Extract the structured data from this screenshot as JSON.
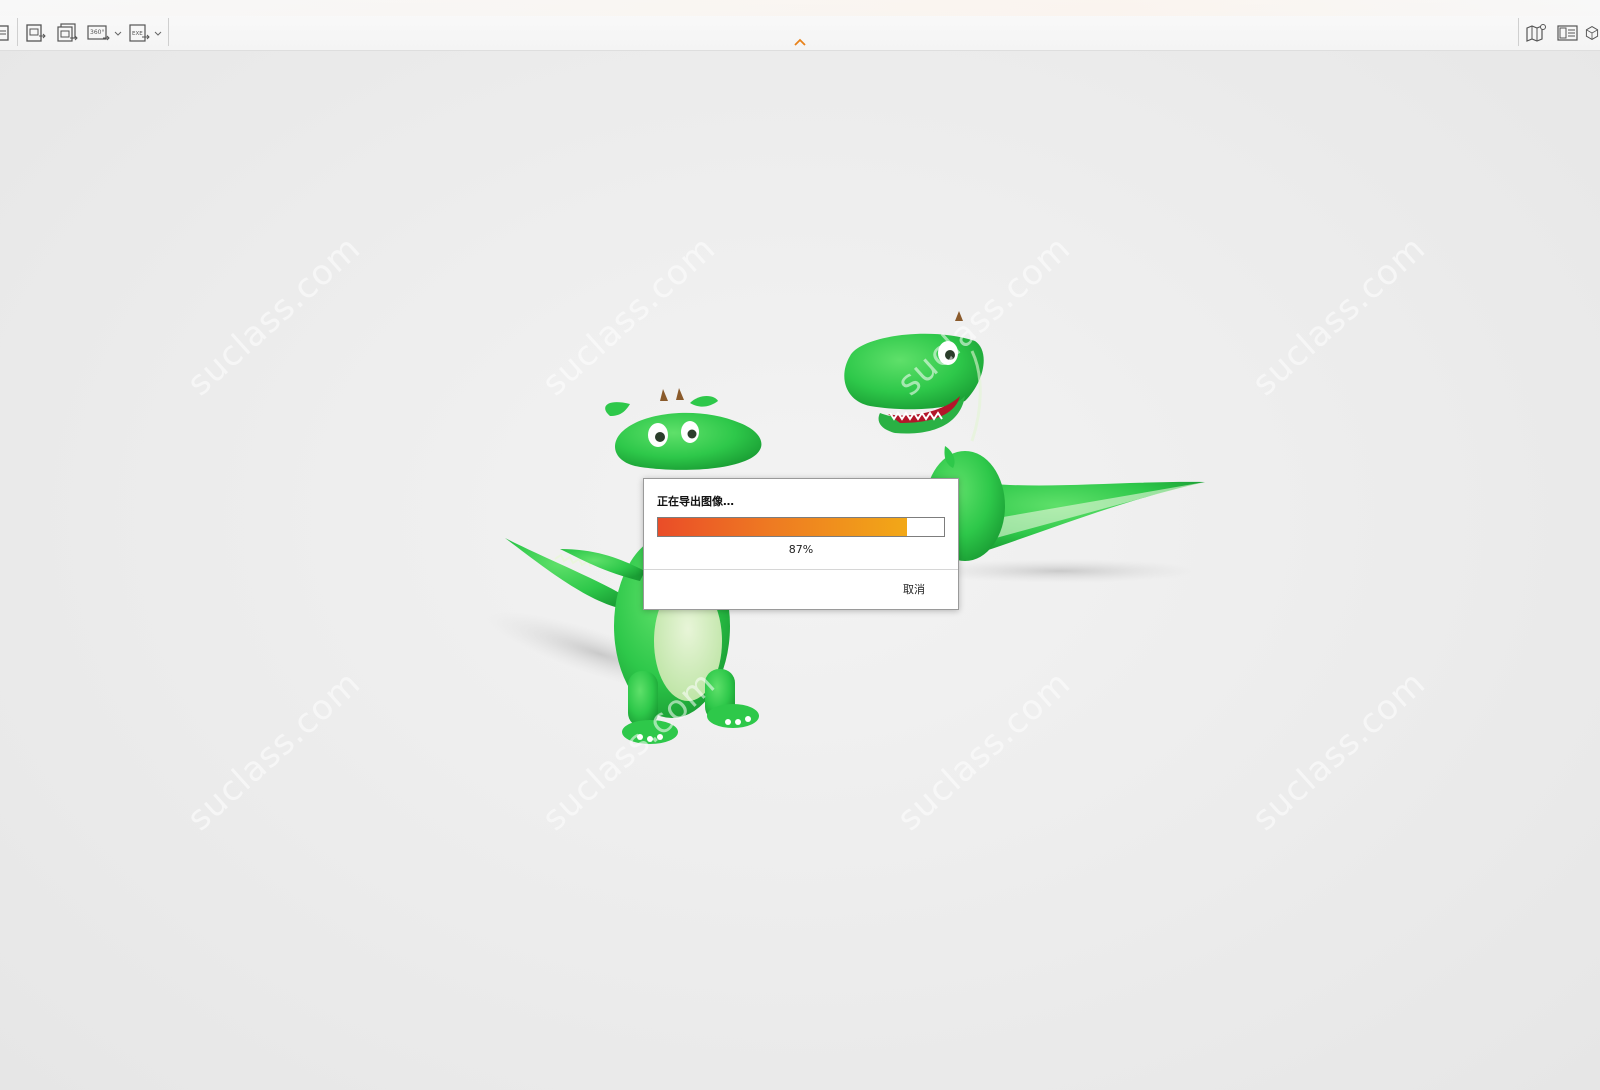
{
  "toolbar": {
    "buttons": [
      {
        "icon": "export-page-icon"
      },
      {
        "icon": "export-images-icon"
      },
      {
        "icon": "export-360-icon",
        "glyph": "360°"
      },
      {
        "icon": "export-exe-icon",
        "glyph": "EXE"
      }
    ],
    "right_buttons": [
      {
        "icon": "map-info-icon"
      },
      {
        "icon": "panel-list-icon"
      },
      {
        "icon": "cube-icon"
      }
    ],
    "accent_color": "#e8821a"
  },
  "viewport": {
    "background": "#ebebeb",
    "watermark": "suclass.com",
    "character_color": "#2ec84a"
  },
  "dialog": {
    "title": "正在导出图像…",
    "progress_percent": 87,
    "progress_text": "87%",
    "cancel_label": "取消"
  }
}
